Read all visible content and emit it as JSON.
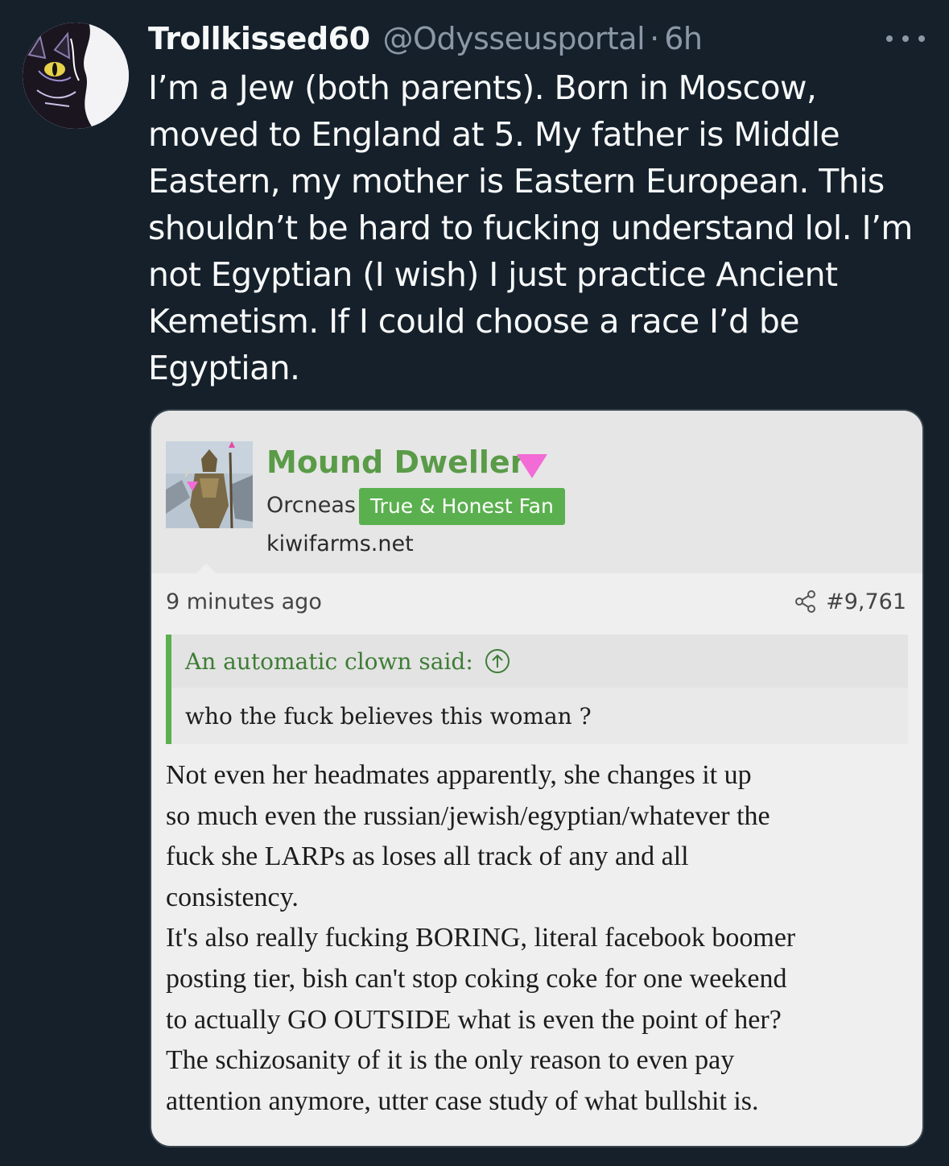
{
  "tweet": {
    "display_name": "Trollkissed60",
    "handle": "@Odysseusportal",
    "separator": "·",
    "time": "6h",
    "text_lines": [
      "I’m a Jew (both parents). Born in Moscow,",
      "moved to England at 5. My father is Middle",
      "Eastern, my mother is Eastern European. This",
      "shouldn’t be hard to fucking understand lol. I’m",
      "not Egyptian (I wish) I just practice Ancient",
      "Kemetism. If I could choose a race I’d be",
      "Egyptian."
    ]
  },
  "embedded_post": {
    "poster_name": "Mound Dweller",
    "poster_title": "Orcneas",
    "badge": "True & Honest Fan",
    "site": "kiwifarms.net",
    "post_time": "9 minutes ago",
    "post_number": "#9,761",
    "quote_author": "An automatic clown said:",
    "quote_text": "who the fuck believes this woman ?",
    "body_lines": [
      "Not even her headmates apparently, she changes it up",
      "so much even the russian/jewish/egyptian/whatever the",
      "fuck she LARPs as loses all track of any and all",
      "consistency.",
      "It's also really fucking BORING, literal facebook boomer",
      "posting tier, bish can't stop coking coke for one weekend",
      "to actually GO OUTSIDE what is even the point of her?",
      "The schizosanity of it is the only reason to even pay",
      "attention anymore, utter case study of what bullshit is."
    ],
    "colors": {
      "name": "#5a9b48",
      "badge": "#5ab04e",
      "rank_triangle": "#f26bd6"
    }
  },
  "icons": {
    "more": "more-horizontal-icon",
    "share": "share-icon",
    "quote_jump": "arrow-up-circle-icon",
    "rank": "pink-triangle-icon"
  }
}
